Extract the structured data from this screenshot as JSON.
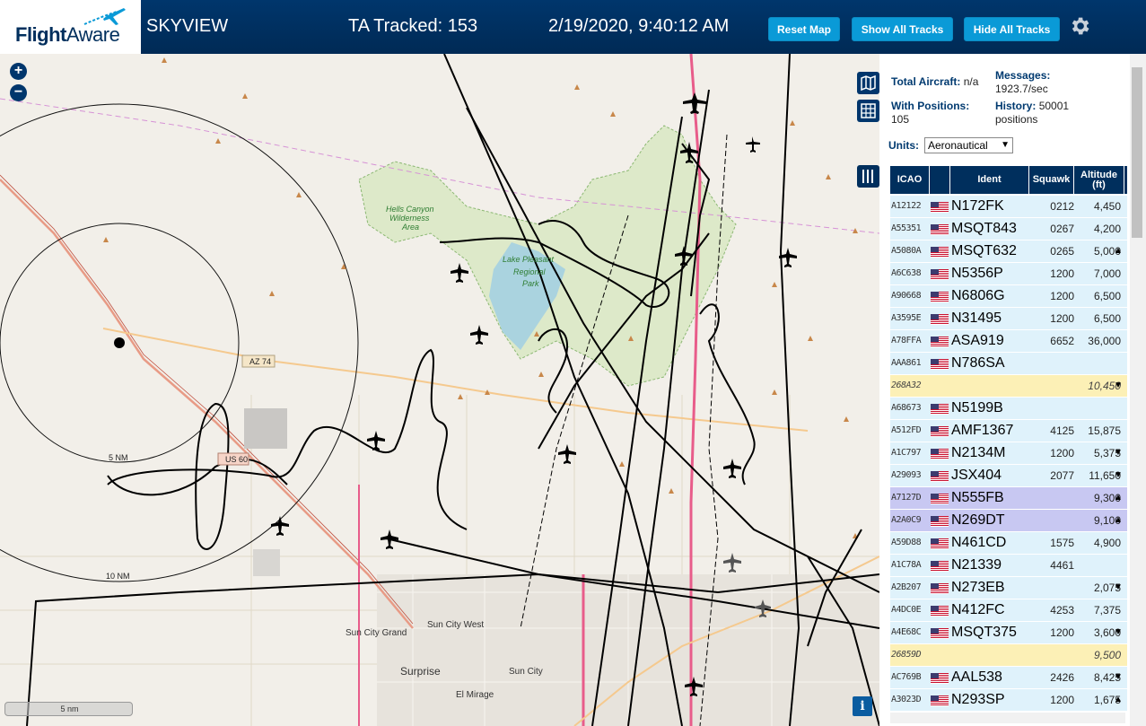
{
  "header": {
    "logo_flight": "Flight",
    "logo_aware": "Aware",
    "title": "SKYVIEW",
    "tracked": "TA Tracked: 153",
    "datetime": "2/19/2020, 9:40:12 AM",
    "btn_reset": "Reset Map",
    "btn_show": "Show All Tracks",
    "btn_hide": "Hide All Tracks",
    "accent": "#0a9ad7",
    "bg": "#002f5d"
  },
  "map": {
    "zoom_in": "+",
    "zoom_out": "−",
    "scale": "5 nm",
    "info": "i",
    "labels": {
      "hells_canyon": "Hells Canyon",
      "wilderness": "Wilderness",
      "area": "Area",
      "lake1": "Lake Pleasant",
      "lake2": "Regional",
      "lake3": "Park",
      "az74": "AZ 74",
      "us60": "US 60",
      "ring5": "5 NM",
      "ring10": "10 NM",
      "sun_city_west": "Sun City West",
      "sun_city_grand": "Sun City Grand",
      "surprise": "Surprise",
      "sun_city": "Sun City",
      "el_mirage": "El Mirage"
    }
  },
  "panel": {
    "total_label": "Total Aircraft:",
    "total_value": "n/a",
    "with_pos_label": "With Positions:",
    "with_pos_value": "105",
    "messages_label": "Messages:",
    "messages_value": "1923.7/sec",
    "history_label": "History:",
    "history_value": "50001",
    "history_unit": "positions",
    "units_label": "Units:",
    "units_value": "Aeronautical",
    "columns": {
      "icao": "ICAO",
      "ident": "Ident",
      "squawk": "Squawk",
      "alt1": "Altitude",
      "alt2": "(ft)"
    }
  },
  "rows": [
    {
      "icao": "A12122",
      "flag": true,
      "ident": "N172FK",
      "squawk": "0212",
      "alt": "4,450",
      "trend": "",
      "style": ""
    },
    {
      "icao": "A55351",
      "flag": true,
      "ident": "MSQT843",
      "squawk": "0267",
      "alt": "4,200",
      "trend": "",
      "style": ""
    },
    {
      "icao": "A5080A",
      "flag": true,
      "ident": "MSQT632",
      "squawk": "0265",
      "alt": "5,000",
      "trend": "▲",
      "style": ""
    },
    {
      "icao": "A6C638",
      "flag": true,
      "ident": "N5356P",
      "squawk": "1200",
      "alt": "7,000",
      "trend": "",
      "style": ""
    },
    {
      "icao": "A90668",
      "flag": true,
      "ident": "N6806G",
      "squawk": "1200",
      "alt": "6,500",
      "trend": "",
      "style": ""
    },
    {
      "icao": "A3595E",
      "flag": true,
      "ident": "N31495",
      "squawk": "1200",
      "alt": "6,500",
      "trend": "",
      "style": ""
    },
    {
      "icao": "A78FFA",
      "flag": true,
      "ident": "ASA919",
      "squawk": "6652",
      "alt": "36,000",
      "trend": "",
      "style": ""
    },
    {
      "icao": "AAA861",
      "flag": true,
      "ident": "N786SA",
      "squawk": "",
      "alt": "",
      "trend": "",
      "style": ""
    },
    {
      "icao": "268A32",
      "flag": false,
      "ident": "",
      "squawk": "",
      "alt": "10,450",
      "trend": "▼",
      "style": "yellow"
    },
    {
      "icao": "A68673",
      "flag": true,
      "ident": "N5199B",
      "squawk": "",
      "alt": "",
      "trend": "",
      "style": ""
    },
    {
      "icao": "A512FD",
      "flag": true,
      "ident": "AMF1367",
      "squawk": "4125",
      "alt": "15,875",
      "trend": "",
      "style": ""
    },
    {
      "icao": "A1C797",
      "flag": true,
      "ident": "N2134M",
      "squawk": "1200",
      "alt": "5,375",
      "trend": "▼",
      "style": ""
    },
    {
      "icao": "A29093",
      "flag": true,
      "ident": "JSX404",
      "squawk": "2077",
      "alt": "11,650",
      "trend": "▼",
      "style": ""
    },
    {
      "icao": "A7127D",
      "flag": true,
      "ident": "N555FB",
      "squawk": "",
      "alt": "9,300",
      "trend": "▲",
      "style": "purple"
    },
    {
      "icao": "A2A0C9",
      "flag": true,
      "ident": "N269DT",
      "squawk": "",
      "alt": "9,100",
      "trend": "▲",
      "style": "purple"
    },
    {
      "icao": "A59D88",
      "flag": true,
      "ident": "N461CD",
      "squawk": "1575",
      "alt": "4,900",
      "trend": "",
      "style": ""
    },
    {
      "icao": "A1C78A",
      "flag": true,
      "ident": "N21339",
      "squawk": "4461",
      "alt": "",
      "trend": "",
      "style": ""
    },
    {
      "icao": "A2B207",
      "flag": true,
      "ident": "N273EB",
      "squawk": "",
      "alt": "2,075",
      "trend": "▼",
      "style": ""
    },
    {
      "icao": "A4DC0E",
      "flag": true,
      "ident": "N412FC",
      "squawk": "4253",
      "alt": "7,375",
      "trend": "",
      "style": ""
    },
    {
      "icao": "A4E68C",
      "flag": true,
      "ident": "MSQT375",
      "squawk": "1200",
      "alt": "3,600",
      "trend": "▼",
      "style": ""
    },
    {
      "icao": "26859D",
      "flag": false,
      "ident": "",
      "squawk": "",
      "alt": "9,500",
      "trend": "",
      "style": "yellow"
    },
    {
      "icao": "AC769B",
      "flag": true,
      "ident": "AAL538",
      "squawk": "2426",
      "alt": "8,425",
      "trend": "▼",
      "style": ""
    },
    {
      "icao": "A3023D",
      "flag": true,
      "ident": "N293SP",
      "squawk": "1200",
      "alt": "1,675",
      "trend": "▲",
      "style": ""
    }
  ]
}
